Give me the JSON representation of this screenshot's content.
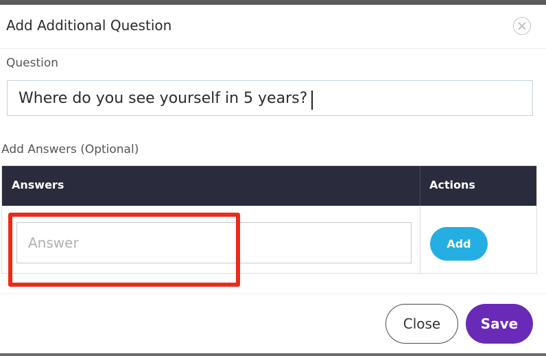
{
  "dialog": {
    "title": "Add Additional Question",
    "close_icon": "close-circle-icon"
  },
  "question": {
    "label": "Question",
    "value": "Where do you see yourself in 5 years?"
  },
  "answers": {
    "section_label": "Add Answers (Optional)",
    "table": {
      "columns": [
        "Answers",
        "Actions"
      ]
    },
    "input_placeholder": "Answer",
    "add_label": "Add"
  },
  "footer": {
    "close_label": "Close",
    "save_label": "Save"
  },
  "colors": {
    "table_header_bg": "#2a2b3c",
    "add_button": "#25aee2",
    "save_button": "#6a2ab8",
    "annotation": "#ee2a17"
  }
}
